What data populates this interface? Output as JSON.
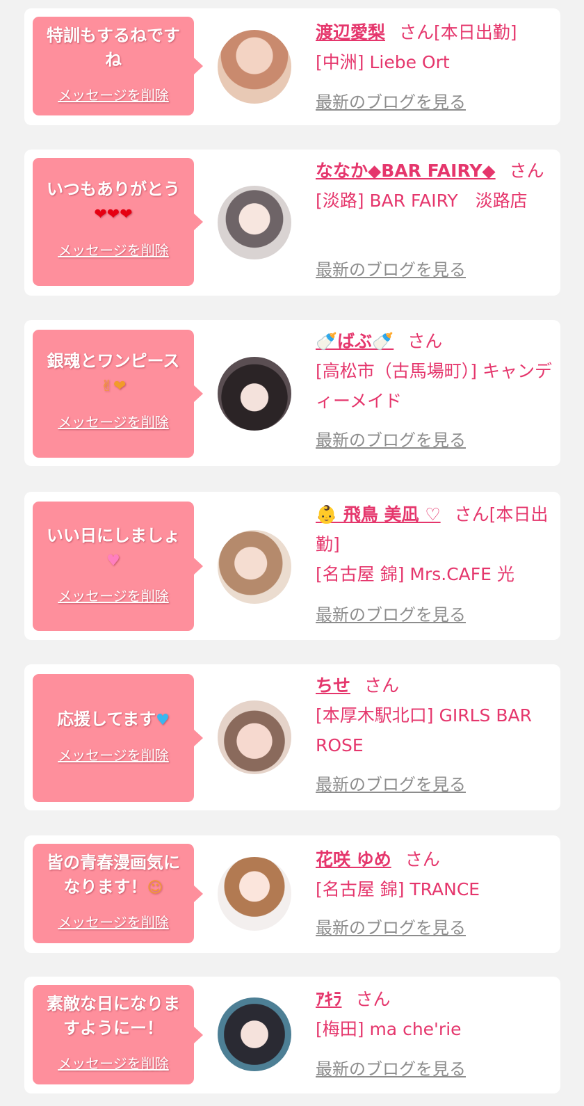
{
  "colors": {
    "page_bg": "#f2f2f2",
    "card_bg": "#ffffff",
    "bubble_bg": "#fe8f9c",
    "accent_pink": "#e5366c",
    "link_gray": "#8d8d8d"
  },
  "delete_label": "メッセージを削除",
  "blog_label": "最新のブログを見る",
  "items": [
    {
      "message_lines": [
        "特訓もするねですね"
      ],
      "message_emoji": "",
      "name": "渡辺愛梨",
      "suffix": "さん[本日出勤]",
      "shop": "[中洲] Liebe Ort"
    },
    {
      "message_lines": [
        "いつもありがとう"
      ],
      "message_emoji": "❤❤❤",
      "name": "ななか◆BAR FAIRY◆",
      "suffix": "さん",
      "shop": "[淡路] BAR FAIRY　淡路店"
    },
    {
      "message_lines": [
        "銀魂とワンピース"
      ],
      "message_emoji": "✌❤",
      "name": "🍼ばぶ🍼",
      "suffix": "さん",
      "shop": "[高松市（古馬場町）] キャンディーメイド"
    },
    {
      "message_lines": [
        "いい日にしましょ"
      ],
      "message_emoji": "♥",
      "name": "👶 飛鳥 美凪 ♡",
      "suffix": "さん[本日出勤]",
      "shop": "[名古屋 錦] Mrs.CAFE 光"
    },
    {
      "message_lines": [
        "応援してます"
      ],
      "message_emoji": "♥",
      "name": "ちせ",
      "suffix": "さん",
      "shop": "[本厚木駅北口] GIRLS BAR ROSE"
    },
    {
      "message_lines": [
        "皆の青春漫画気になります！"
      ],
      "message_emoji": "☺",
      "name": "花咲 ゆめ",
      "suffix": "さん",
      "shop": "[名古屋 錦] TRANCE"
    },
    {
      "message_lines": [
        "素敵な日になりますようにー！"
      ],
      "message_emoji": "",
      "name": "ｱｷﾗ",
      "suffix": "さん",
      "shop": "[梅田] ma che'rie"
    }
  ]
}
